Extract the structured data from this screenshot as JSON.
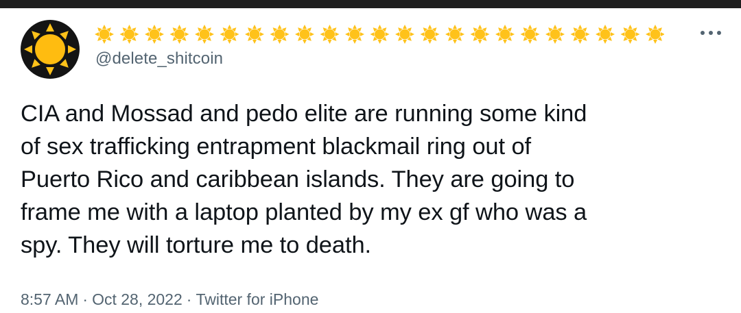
{
  "tweet": {
    "display_name": "☀☀☀☀☀☀☀☀☀☀☀☀☀☀☀☀☀☀☀☀☀☀☀...",
    "handle": "@delete_shitcoin",
    "text": "CIA and Mossad and pedo elite are running some kind\nof sex trafficking entrapment blackmail ring out of\nPuerto Rico and caribbean islands. They are going to\nframe me with a laptop planted by my ex gf who was a\nspy. They will torture me to death.",
    "time": "8:57 AM",
    "separator": "·",
    "date": "Oct 28, 2022",
    "source": "Twitter for iPhone",
    "more_label": "···"
  },
  "icons": {
    "avatar": "sun-emoji-avatar",
    "display_name_glyph": "sun-emoji",
    "more": "more-dots-icon"
  },
  "colors": {
    "text": "#0f1419",
    "secondary": "#536471",
    "avatar_bg": "#141414",
    "sun": "#ffc21a",
    "top_bar": "#1f1f1f"
  }
}
